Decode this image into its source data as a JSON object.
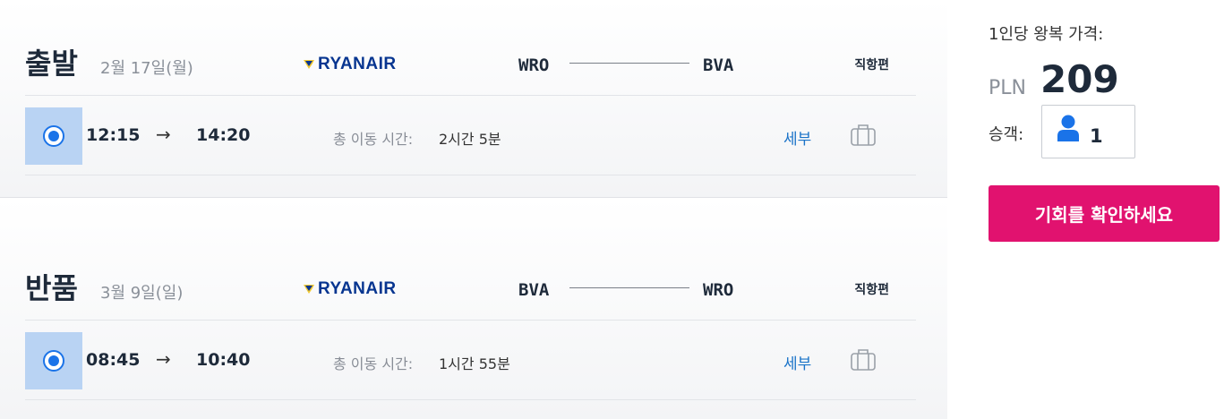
{
  "outbound": {
    "title": "출발",
    "date": "2월 17일(월)",
    "airline": "RYANAIR",
    "from": "WRO",
    "to": "BVA",
    "flight_type": "직항편",
    "depart_time": "12:15",
    "arrow": "→",
    "arrive_time": "14:20",
    "duration_label": "총 이동 시간:",
    "duration": "2시간 5분",
    "details_label": "세부",
    "selected": true
  },
  "return": {
    "title": "반품",
    "date": "3월 9일(일)",
    "airline": "RYANAIR",
    "from": "BVA",
    "to": "WRO",
    "flight_type": "직항편",
    "depart_time": "08:45",
    "arrow": "→",
    "arrive_time": "10:40",
    "duration_label": "총 이동 시간:",
    "duration": "1시간 55분",
    "details_label": "세부",
    "selected": true
  },
  "summary": {
    "per_person_label": "1인당 왕복 가격:",
    "currency": "PLN",
    "price": "209",
    "passengers_label": "승객:",
    "passengers": "1",
    "cta_label": "기회를 확인하세요"
  },
  "colors": {
    "accent_blue": "#1a73e8",
    "cta_pink": "#e1126f",
    "ryanair_navy": "#073590",
    "ryanair_gold": "#f1c933"
  },
  "icons": [
    "ryanair-harp-icon",
    "radio-selected-icon",
    "baggage-icon",
    "person-icon"
  ]
}
